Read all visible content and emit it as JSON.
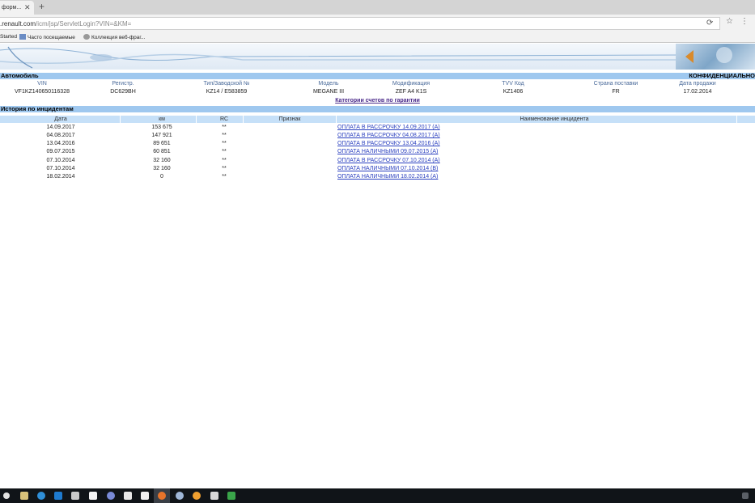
{
  "browser": {
    "tab_title": "форм...",
    "tab_close": "✕",
    "new_tab": "+",
    "url_host": ".renault.com",
    "url_path": "/icm/jsp/ServletLogin?VIN=&KM=",
    "reload_icon": "⟳",
    "star_icon": "☆",
    "menu_icon": "⋮",
    "bookmarks": [
      {
        "label": "Started"
      },
      {
        "label": "Часто посещаемые"
      },
      {
        "label": "Коллекция веб-фраг..."
      }
    ]
  },
  "vehicle": {
    "section_title": "Автомобиль",
    "confidential": "КОНФИДЕНЦИАЛЬНО",
    "headers": [
      "VIN",
      "Регистр.",
      "Тип/Заводской №",
      "Модель",
      "Модификация",
      "TVV Код",
      "Страна поставки",
      "Дата продажи"
    ],
    "values": [
      "VF1KZ140650116328",
      "DC629BH",
      "KZ14 / E583859",
      "MEGANE III",
      "ZEF A4 K1S",
      "KZ1406",
      "FR",
      "17.02.2014"
    ],
    "warranty_link": "Категории счетов по гарантии"
  },
  "history": {
    "section_title": "История по инцидентам",
    "headers": [
      "Дата",
      "км",
      "RC",
      "Признак",
      "Наименование инцидента"
    ],
    "rows": [
      {
        "date": "14.09.2017",
        "km": "153 675",
        "rc": "**",
        "name": "ОПЛАТА В РАССРОЧКУ 14.09.2017 (А)"
      },
      {
        "date": "04.08.2017",
        "km": "147 921",
        "rc": "**",
        "name": "ОПЛАТА В РАССРОЧКУ 04.08.2017 (А)"
      },
      {
        "date": "13.04.2016",
        "km": "89 651",
        "rc": "**",
        "name": "ОПЛАТА В РАССРОЧКУ 13.04.2016 (А)"
      },
      {
        "date": "09.07.2015",
        "km": "60 851",
        "rc": "**",
        "name": "ОПЛАТА НАЛИЧНЫМИ 09.07.2015 (А)"
      },
      {
        "date": "07.10.2014",
        "km": "32 160",
        "rc": "**",
        "name": "ОПЛАТА В РАССРОЧКУ 07.10.2014 (А)"
      },
      {
        "date": "07.10.2014",
        "km": "32 160",
        "rc": "**",
        "name": "ОПЛАТА НАЛИЧНЫМИ 07.10.2014 (B)"
      },
      {
        "date": "18.02.2014",
        "km": "0",
        "rc": "**",
        "name": "ОПЛАТА НАЛИЧНЫМИ 18.02.2014 (А)"
      }
    ]
  },
  "colors": {
    "section_bar": "#9fc8ef",
    "history_header": "#c6e0f8",
    "link": "#2a3fbf",
    "warranty_link": "#4b2a8a",
    "taskbar": "#101418"
  }
}
